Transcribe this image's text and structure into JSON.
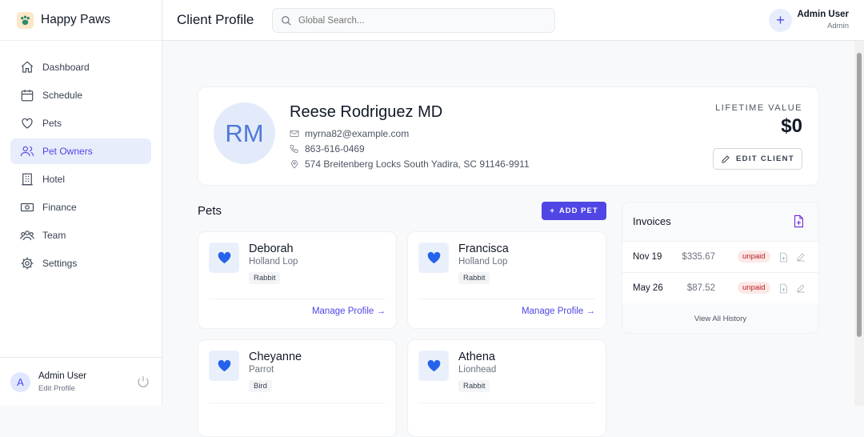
{
  "brand": {
    "name": "Happy Paws"
  },
  "sidebar": {
    "items": [
      {
        "label": "Dashboard",
        "icon": "home-icon"
      },
      {
        "label": "Schedule",
        "icon": "calendar-icon"
      },
      {
        "label": "Pets",
        "icon": "heart-icon"
      },
      {
        "label": "Pet Owners",
        "icon": "users-icon"
      },
      {
        "label": "Hotel",
        "icon": "building-icon"
      },
      {
        "label": "Finance",
        "icon": "cash-icon"
      },
      {
        "label": "Team",
        "icon": "team-icon"
      },
      {
        "label": "Settings",
        "icon": "gear-icon"
      }
    ],
    "active": "Pet Owners",
    "user": {
      "initial": "A",
      "name": "Admin User",
      "link": "Edit Profile"
    }
  },
  "header": {
    "title": "Client Profile",
    "search_placeholder": "Global Search...",
    "user_name": "Admin User",
    "user_role": "Admin"
  },
  "client": {
    "initials": "RM",
    "name": "Reese Rodriguez MD",
    "email": "myrna82@example.com",
    "phone": "863-616-0469",
    "address": "574 Breitenberg Locks South Yadira, SC 91146-9911",
    "lifetime_label": "LIFETIME VALUE",
    "lifetime_value": "$0",
    "edit_label": "EDIT CLIENT"
  },
  "pets": {
    "title": "Pets",
    "add_label": "ADD PET",
    "items": [
      {
        "name": "Deborah",
        "breed": "Holland Lop",
        "type": "Rabbit",
        "link": "Manage Profile →"
      },
      {
        "name": "Francisca",
        "breed": "Holland Lop",
        "type": "Rabbit",
        "link": "Manage Profile →"
      },
      {
        "name": "Cheyanne",
        "breed": "Parrot",
        "type": "Bird"
      },
      {
        "name": "Athena",
        "breed": "Lionhead",
        "type": "Rabbit"
      }
    ]
  },
  "invoices": {
    "title": "Invoices",
    "rows": [
      {
        "date": "Nov 19",
        "amount": "$335.67",
        "status": "unpaid"
      },
      {
        "date": "May 26",
        "amount": "$87.52",
        "status": "unpaid"
      }
    ],
    "history": "View All History"
  },
  "colors": {
    "accent": "#4f46e5",
    "heart": "#2563eb",
    "unpaid": "#b91c1c"
  }
}
